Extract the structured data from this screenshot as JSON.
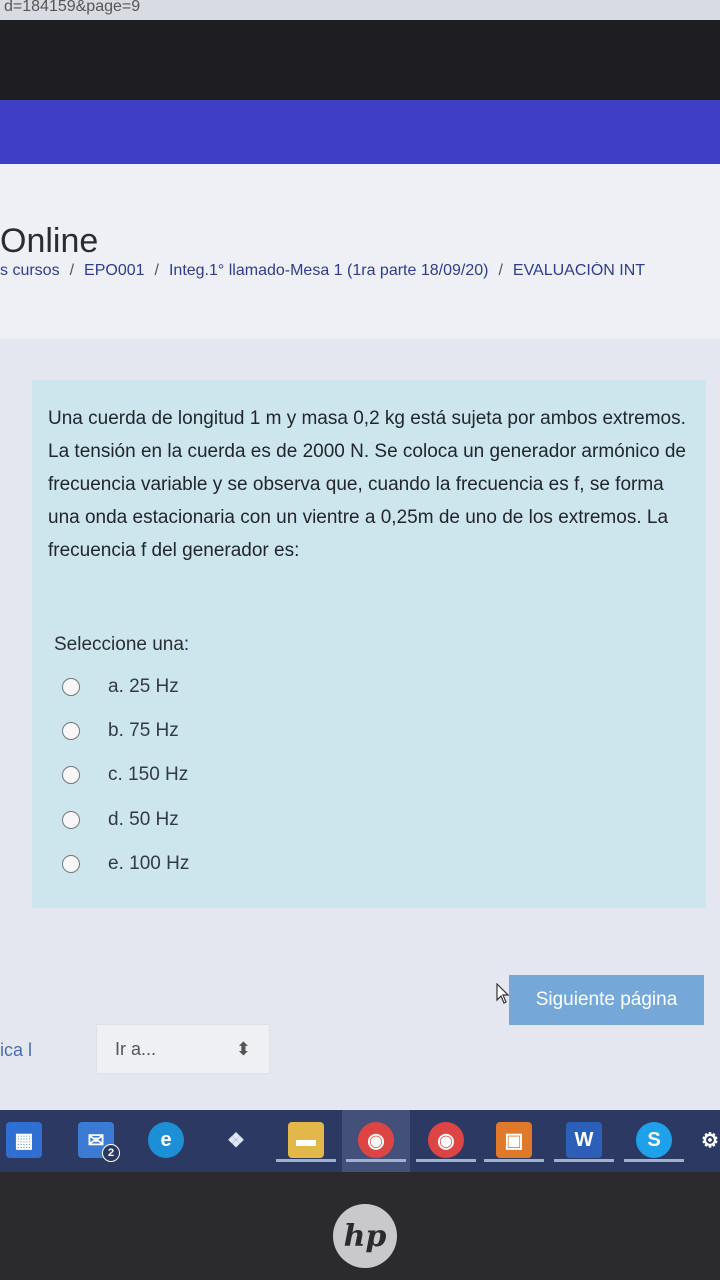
{
  "browser": {
    "url_fragment": "d=184159&page=9"
  },
  "site": {
    "title": "Online"
  },
  "breadcrumb": [
    {
      "label": "s cursos"
    },
    {
      "label": "EPO001"
    },
    {
      "label": "Integ.1° llamado-Mesa 1 (1ra parte 18/09/20)"
    },
    {
      "label": "EVALUACIÓN INT"
    }
  ],
  "question": {
    "text": "Una cuerda de longitud 1 m  y masa 0,2 kg está sujeta por ambos extremos. La tensión en la cuerda es de 2000 N. Se coloca un generador armónico de frecuencia variable y se observa que, cuando la frecuencia es f,  se forma una onda estacionaria con un vientre a 0,25m de uno de los extremos. La frecuencia f del generador es:",
    "prompt": "Seleccione una:",
    "options": [
      {
        "label": "a. 25 Hz",
        "selected": false
      },
      {
        "label": "b. 75 Hz",
        "selected": false
      },
      {
        "label": "c. 150 Hz",
        "selected": false
      },
      {
        "label": "d. 50 Hz",
        "selected": false
      },
      {
        "label": "e. 100 Hz",
        "selected": false
      }
    ]
  },
  "navigation": {
    "next_button": "Siguiente página",
    "left_link": "ica l",
    "jump_placeholder": "Ir a...",
    "jump_arrow": "⬍"
  },
  "taskbar": {
    "mail_badge": "2",
    "icons": [
      "store-icon",
      "mail-icon",
      "edge-icon",
      "dropbox-icon",
      "file-explorer-icon",
      "chrome-icon",
      "chrome-profile-icon",
      "photo-app-icon",
      "word-icon",
      "skype-icon",
      "settings-icon"
    ]
  },
  "laptop": {
    "logo": "hp"
  },
  "colors": {
    "brand_bar": "#3f3fc6",
    "question_bg": "#cde6ee",
    "next_button": "#75a7d8",
    "taskbar": "#2c3a63"
  }
}
